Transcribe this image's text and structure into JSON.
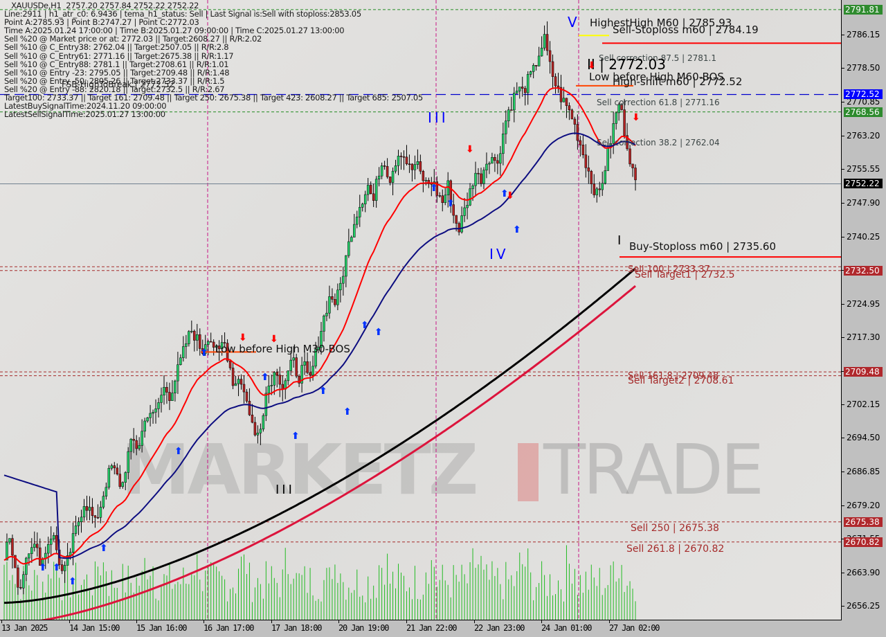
{
  "chart_data": {
    "type": "candlestick",
    "symbol": "XAUUSDe",
    "timeframe": "H1",
    "ohlc_header": "XAUUSDe,H1  2757.20 2757.84 2752.22 2752.22",
    "ylim": [
      2653.0,
      2794.0
    ],
    "y_ticks": [
      "2786.15",
      "2778.50",
      "2770.85",
      "2763.20",
      "2755.55",
      "2747.90",
      "2740.25",
      "2732.60",
      "2724.95",
      "2717.30",
      "2709.65",
      "2702.15",
      "2694.50",
      "2686.85",
      "2679.20",
      "2671.55",
      "2663.90",
      "2656.25"
    ],
    "x_ticks": [
      "13 Jan 2025",
      "14 Jan 15:00",
      "15 Jan 16:00",
      "16 Jan 17:00",
      "17 Jan 18:00",
      "20 Jan 19:00",
      "21 Jan 22:00",
      "22 Jan 23:00",
      "24 Jan 01:00",
      "27 Jan 02:00"
    ],
    "price_badges": [
      {
        "value": "2791.81",
        "color": "#2e8b2e"
      },
      {
        "value": "2772.52",
        "color": "#0000ff"
      },
      {
        "value": "2768.56",
        "color": "#2e8b2e"
      },
      {
        "value": "2752.22",
        "color": "#000000"
      },
      {
        "value": "2732.50",
        "color": "#b0282c"
      },
      {
        "value": "2709.48",
        "color": "#b0282c"
      },
      {
        "value": "2675.38",
        "color": "#b0282c"
      },
      {
        "value": "2670.82",
        "color": "#b0282c"
      }
    ],
    "close_path": [
      2668,
      2672,
      2664,
      2660,
      2667,
      2671,
      2669,
      2666,
      2670,
      2673,
      2668,
      2663,
      2667,
      2672,
      2676,
      2680,
      2678,
      2675,
      2679,
      2684,
      2688,
      2686,
      2683,
      2690,
      2694,
      2692,
      2697,
      2701,
      2699,
      2703,
      2706,
      2704,
      2708,
      2712,
      2716,
      2719,
      2717,
      2714,
      2718,
      2716,
      2713,
      2717,
      2712,
      2706,
      2709,
      2704,
      2700,
      2694,
      2698,
      2705,
      2708,
      2710,
      2706,
      2709,
      2712,
      2708,
      2711,
      2707,
      2712,
      2718,
      2723,
      2727,
      2725,
      2730,
      2736,
      2742,
      2746,
      2749,
      2752,
      2748,
      2755,
      2758,
      2753,
      2757,
      2760,
      2758,
      2755,
      2757,
      2754,
      2752,
      2753,
      2750,
      2748,
      2752,
      2745,
      2742,
      2746,
      2750,
      2755,
      2753,
      2757,
      2759,
      2756,
      2762,
      2768,
      2771,
      2774,
      2773,
      2776,
      2778,
      2782,
      2785,
      2779,
      2775,
      2772,
      2770,
      2768,
      2764,
      2760,
      2756,
      2752,
      2749,
      2754,
      2760,
      2766,
      2771,
      2764,
      2758,
      2752
    ],
    "series": [
      {
        "name": "EMA fast (red)",
        "color": "#ff0000"
      },
      {
        "name": "EMA mid (navy)",
        "color": "#0d0d80"
      },
      {
        "name": "MA slow (black)",
        "color": "#000000"
      },
      {
        "name": "MA 200 (crimson)",
        "color": "#dc143c"
      },
      {
        "name": "Volume",
        "color": "#22bb22"
      }
    ],
    "horizontal_levels": [
      {
        "label": "HighestHigh   M60 | 2785.93",
        "price": 2785.93,
        "color": "#ffff00"
      },
      {
        "label": "Sell-Stoploss m60 | 2784.19",
        "price": 2784.19,
        "color": "#ff0000"
      },
      {
        "label": "Sell correction 87.5 | 2781.1",
        "price": 2781.1,
        "color": "#404848"
      },
      {
        "label": "II | 2772.03",
        "price": 2772.03,
        "color": "#000000"
      },
      {
        "label": "Low before High   M60-BOS",
        "price": 2774.5,
        "color": "#ff4500"
      },
      {
        "label": "High-shift m60 | 2772.52",
        "price": 2772.52,
        "color": "#0000cd"
      },
      {
        "label": "Sell correction 61.8 | 2771.16",
        "price": 2771.16,
        "color": "#404848"
      },
      {
        "label": "Sell correction 38.2 | 2762.04",
        "price": 2762.04,
        "color": "#404848"
      },
      {
        "label": "Buy-Stoploss m60 | 2735.60",
        "price": 2735.6,
        "color": "#ff0000"
      },
      {
        "label": "Sell 100 | 2733.37",
        "price": 2733.37,
        "color": "#b0282c"
      },
      {
        "label": "Sell Target1 | 2732.5",
        "price": 2732.5,
        "color": "#b0282c"
      },
      {
        "label": "Sell 161.8 | 2709.48",
        "price": 2709.48,
        "color": "#b0282c"
      },
      {
        "label": "Sell Target2 | 2708.61",
        "price": 2708.61,
        "color": "#b0282c"
      },
      {
        "label": "Sell  250 | 2675.38",
        "price": 2675.38,
        "color": "#b0282c"
      },
      {
        "label": "Sell  261.8 | 2670.82",
        "price": 2670.82,
        "color": "#b0282c"
      },
      {
        "label": "Low before High   M30-BOS",
        "price": 2714.0,
        "color": "#ff4500"
      },
      {
        "label": "FSB-HighToBreak | 2772.52",
        "price": 2772.52,
        "color": "#000000"
      }
    ],
    "wave_labels": [
      {
        "label": "V",
        "color": "#0000ff"
      },
      {
        "label": "III",
        "color": "#0000ff"
      },
      {
        "label": "IV",
        "color": "#0000ff"
      },
      {
        "label": "III",
        "color": "#000000"
      },
      {
        "label": "I",
        "color": "#000000"
      }
    ]
  },
  "info_panel": [
    "XAUUSDe,H1  2757.20 2757.84 2752.22 2752.22",
    "Line:2911 | h1_atr_c0: 6.9436 | tema_h1_status: Sell | Last Signal is:Sell with stoploss:2853.05",
    "Point A:2785.93 | Point B:2747.27 | Point C:2772.03",
    "Time A:2025.01.24 17:00:00 | Time B:2025.01.27 09:00:00 | Time C:2025.01.27 13:00:00",
    "Sell %20 @ Market price or at: 2772.03 || Target:2608.27 || R/R:2.02",
    "Sell %10 @ C_Entry38: 2762.04 || Target:2507.05 || R/R:2.8",
    "Sell %10 @ C_Entry61: 2771.16 || Target:2675.38 || R/R:1.17",
    "Sell %10 @ C_Entry88: 2781.1 || Target:2708.61 || R/R:1.01",
    "Sell %10 @ Entry -23: 2795.05 || Target:2709.48 || R/R:1.48",
    "Sell %20 @ Entry -50: 2805.26 || Target:2733.37 || R/R:1.5",
    "Sell %20 @ Entry -88: 2820.18 || Target:2732.5 || R/R:2.67",
    "Target100: 2733.37 || Target 161: 2709.48 || Target 250: 2675.38 || Target 423: 2608.27 || Target 685: 2507.05",
    "LatestBuySignalTime:2024.11.20 09:00:00",
    "LatestSellSignalTime:2025.01.27 13:00:00"
  ],
  "watermark": {
    "left": "MARKETZ",
    "right": "TRADE"
  }
}
